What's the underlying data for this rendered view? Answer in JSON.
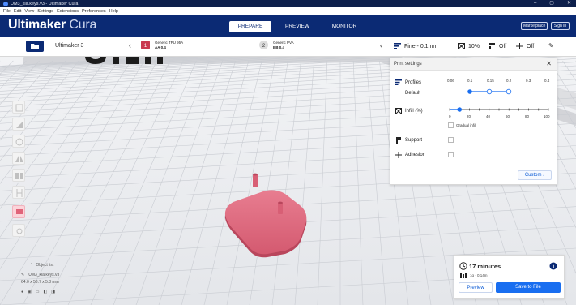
{
  "window": {
    "title": "UM3_kia.keys.v3 - Ultimaker Cura",
    "controls": [
      "–",
      "▢",
      "✕"
    ]
  },
  "menu": {
    "items": [
      "File",
      "Edit",
      "View",
      "Settings",
      "Extensions",
      "Preferences",
      "Help"
    ]
  },
  "header": {
    "brand_primary": "Ultimaker",
    "brand_secondary": "Cura",
    "stages": [
      "PREPARE",
      "PREVIEW",
      "MONITOR"
    ],
    "active_stage": "PREPARE",
    "marketplace_label": "Marketplace",
    "signin_label": "Sign in"
  },
  "printer": {
    "name": "Ultimaker 3"
  },
  "extruders": [
    {
      "number": "1",
      "material": "Generic TPU 95A",
      "core": "AA 0.4",
      "color": "#c9384f"
    },
    {
      "number": "2",
      "material": "Generic PVA",
      "core": "BB 0.4",
      "color": "#dcdcdc"
    }
  ],
  "profile_bar": {
    "quality": "Fine - 0.1mm",
    "infill": "10%",
    "support": "Off",
    "adhesion": "Off"
  },
  "print_settings": {
    "title": "Print settings",
    "profiles_label": "Profiles",
    "profile_value": "Default",
    "profile_ticks": [
      "0.06",
      "0.1",
      "0.15",
      "0.2",
      "0.3",
      "0.4"
    ],
    "infill_label": "Infill (%)",
    "infill_ticks": [
      "0",
      "20",
      "40",
      "60",
      "80",
      "100"
    ],
    "infill_value": 10,
    "gradual_infill_label": "Gradual infill",
    "support_label": "Support",
    "adhesion_label": "Adhesion",
    "custom_label": "Custom"
  },
  "objects": {
    "header": "Object list",
    "item": "UM3_kia.keys.v3",
    "dimensions": "64.0 x 53.7 x 5.8 mm"
  },
  "estimate": {
    "time": "17 minutes",
    "material": "1g · 0.14m",
    "preview_label": "Preview",
    "save_label": "Save to File"
  },
  "colors": {
    "header_bg": "#0b2a74",
    "accent": "#196ef0",
    "model": "#e06479"
  }
}
